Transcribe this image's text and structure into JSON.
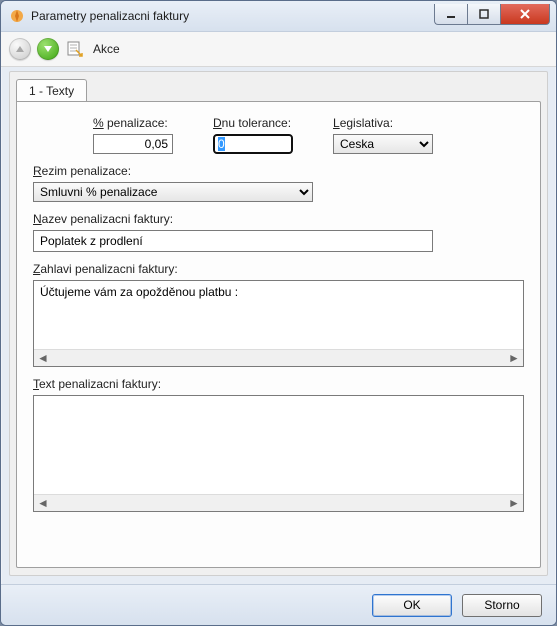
{
  "window": {
    "title": "Parametry penalizacni faktury"
  },
  "titlebar_buttons": {
    "min": "minimize",
    "max": "maximize",
    "close": "close"
  },
  "toolbar": {
    "action_label": "Akce"
  },
  "tabs": [
    {
      "label": "1 - Texty"
    }
  ],
  "fields": {
    "pct_penalty": {
      "label": "% penalizace:",
      "value": "0,05"
    },
    "days_tolerance": {
      "label": "Dnu tolerance:",
      "value": "0"
    },
    "legislation": {
      "label": "Legislativa:",
      "value": "Ceska"
    },
    "penalty_mode": {
      "label": "Rezim penalizace:",
      "value": "Smluvni % penalizace"
    },
    "invoice_name": {
      "label": "Nazev penalizacni faktury:",
      "value": "Poplatek z prodlení"
    },
    "invoice_header": {
      "label": "Zahlavi penalizacni faktury:",
      "value": "Účtujeme vám za opožděnou platbu :"
    },
    "invoice_text": {
      "label": "Text penalizacni faktury:",
      "value": ""
    }
  },
  "buttons": {
    "ok": "OK",
    "cancel": "Storno"
  },
  "underline": {
    "pct_penalty": "%",
    "days_tolerance": "D",
    "legislation": "L",
    "penalty_mode": "R",
    "invoice_name": "N",
    "invoice_header": "Z",
    "invoice_text": "T"
  }
}
